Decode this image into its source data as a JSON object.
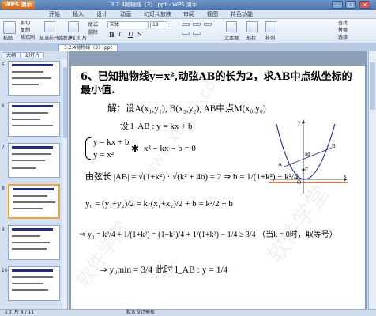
{
  "titlebar": {
    "app_button": "WPS 演示",
    "title": "3.2.4抛物线（3）.ppt - WPS 演示",
    "min": "–",
    "max": "□",
    "close": "×"
  },
  "menu": {
    "items": [
      "开始",
      "插入",
      "设计",
      "动画",
      "幻灯片放映",
      "审阅",
      "视图",
      "特色功能"
    ]
  },
  "ribbon": {
    "paste": "粘贴",
    "cut": "剪切",
    "copy": "复制",
    "format_painter": "格式刷",
    "from_current": "从当前开始",
    "new_slide": "新建幻灯片",
    "layout": "版式",
    "delete": "删除",
    "font_name": "宋体",
    "font_size": "18",
    "bold": "B",
    "italic": "I",
    "underline": "U",
    "shadow": "S",
    "textbox": "文本框",
    "shape": "形状",
    "arrange": "排列",
    "find": "查找",
    "replace": "替换",
    "select": "选择"
  },
  "tabs": {
    "document": "3.2.4抛物线（3）.ppt"
  },
  "side_panel": {
    "tab_outline": "大纲",
    "tab_slides": "幻灯片",
    "slide_numbers": [
      "5",
      "6",
      "7",
      "8",
      "9",
      "10"
    ]
  },
  "slide": {
    "problem": "6、已知抛物线y=x²,动弦AB的长为2，求AB中点纵坐标的最小值.",
    "solution_line": "解：设A(x₁,y₁), B(x₂,y₂), AB中点M(x₀,y₀)",
    "set_line": "设 l_AB : y = kx + b",
    "sys1": "y = kx + b",
    "sys2": "y = x²",
    "elim": "x² − kx − b = 0",
    "chord": "由弦长 |AB| = √(1+k²) · √(k² + 4b) = 2  ⇒  b = 1/(1+k²) − k²/4",
    "y0_line": "y₀ = (y₁+y₂)/2 = k·(x₁+x₂)/2 + b = k²/2 + b",
    "ineq_line": "⇒ y₀ = k²/4 + 1/(1+k²) = (1+k²)/4 + 1/(1+k²) − 1/4 ≥ 3/4  （当k = 0时，取等号）",
    "min_line": "⇒ y₀min = 3/4     此时 l_AB : y = 1/4"
  },
  "graph": {
    "labels": [
      "y",
      "x",
      "A",
      "B",
      "M",
      "F",
      "O"
    ]
  },
  "watermark": [
    "www.xue51.com",
    "软件学堂",
    "软件学堂"
  ],
  "statusbar": {
    "slide_info": "幻灯片 8 / 11",
    "theme": "默认设计模板"
  },
  "colors": {
    "orange_axis": "#c8501a",
    "parabola": "#2233aa",
    "accent": "#f2a33a"
  }
}
